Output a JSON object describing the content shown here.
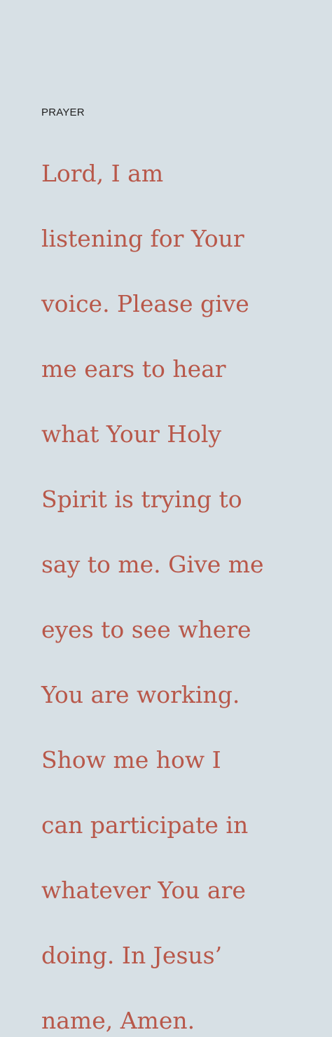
{
  "label": "PRAYER",
  "prayer_lines": [
    "Lord, I am",
    "listening for Your",
    "voice. Please give",
    "me ears to hear",
    "what Your Holy",
    "Spirit is trying to",
    "say to me. Give me",
    "eyes to see where",
    "You are working.",
    "Show me how I",
    "can participate in",
    "whatever You are",
    "doing. In Jesus’",
    "name, Amen."
  ],
  "colors": {
    "background": "#d7e0e5",
    "label": "#1f1f1f",
    "prayer_text": "#b8584a"
  }
}
